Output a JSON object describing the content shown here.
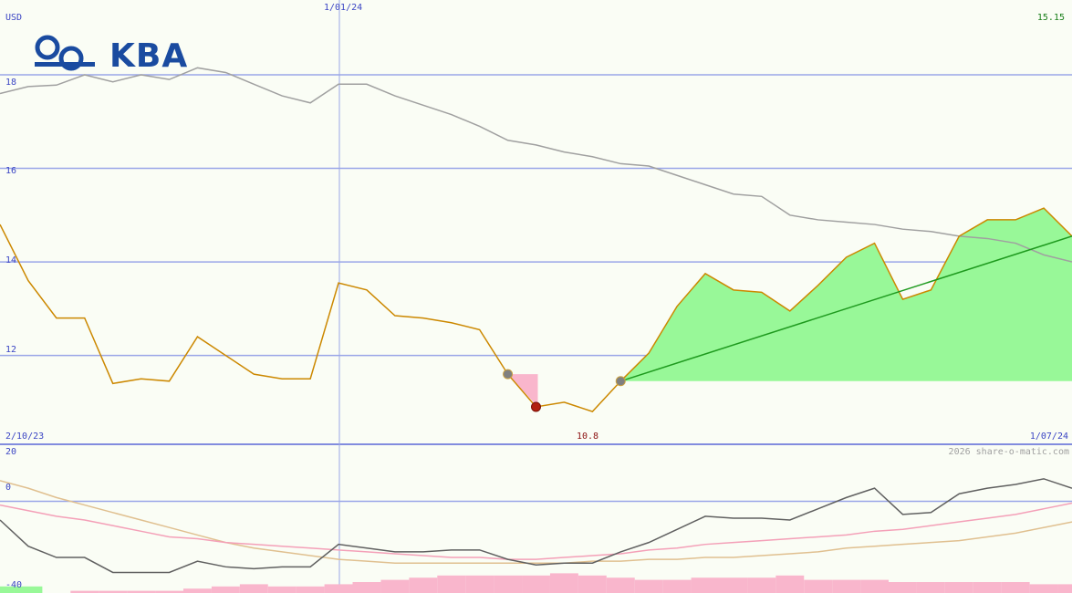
{
  "header": {
    "currency": "USD",
    "date_marker": "1/01/24",
    "last_price": "15.15",
    "start_date": "2/10/23",
    "end_date": "1/07/24",
    "low_label": "10.8",
    "copyright": "2026 share-o-matic.com"
  },
  "logo": {
    "text": "KBA",
    "icon": "kba-rings-logo-icon"
  },
  "colors": {
    "price": "#cc8800",
    "average": "#a0a0a0",
    "trend": "#1e9a1e",
    "gain_fill": "#98f898",
    "loss_fill": "#f9b6cc",
    "grid": "#9aa6e8",
    "axis_text": "#3b45c4"
  },
  "chart_data": [
    {
      "type": "line",
      "title": "",
      "xlabel": "",
      "ylabel": "USD",
      "ylim": [
        10.1,
        19.6
      ],
      "yticks": [
        12,
        14,
        16,
        18
      ],
      "x_range": [
        "2/10/23",
        "1/07/24"
      ],
      "x_marker": "1/01/24",
      "grid": true,
      "series": [
        {
          "role": "price",
          "values": [
            14.8,
            13.6,
            12.8,
            12.8,
            11.4,
            11.5,
            11.45,
            12.4,
            12.0,
            11.6,
            11.5,
            11.5,
            13.55,
            13.4,
            12.85,
            12.8,
            12.7,
            12.55,
            11.6,
            10.9,
            11.0,
            10.8,
            11.45,
            12.05,
            13.05,
            13.75,
            13.4,
            13.35,
            12.95,
            13.5,
            14.1,
            14.4,
            13.2,
            13.4,
            14.55,
            14.9,
            14.9,
            15.15,
            14.55
          ]
        },
        {
          "role": "moving-average",
          "values": [
            17.6,
            17.75,
            17.78,
            18.0,
            17.85,
            18.0,
            17.9,
            18.15,
            18.05,
            17.8,
            17.55,
            17.4,
            17.8,
            17.8,
            17.55,
            17.35,
            17.15,
            16.9,
            16.6,
            16.5,
            16.35,
            16.25,
            16.1,
            16.05,
            15.85,
            15.65,
            15.45,
            15.4,
            15.0,
            14.9,
            14.85,
            14.8,
            14.7,
            14.65,
            14.55,
            14.5,
            14.4,
            14.15,
            14.0
          ]
        }
      ],
      "trend_line": {
        "from": {
          "index": 22,
          "value": 11.45
        },
        "to": {
          "index": 38,
          "value": 14.55
        }
      },
      "annotations": [
        {
          "index": 18,
          "value": 11.6,
          "kind": "marker-grey"
        },
        {
          "index": 19,
          "value": 10.9,
          "kind": "marker-red-low"
        },
        {
          "index": 22,
          "value": 11.45,
          "kind": "marker-grey"
        }
      ]
    },
    {
      "type": "line",
      "title": "",
      "ylim": [
        -40,
        20
      ],
      "yticks": [
        20,
        0,
        -40
      ],
      "grid": true,
      "series": [
        {
          "role": "oscillator",
          "values": [
            -10,
            -24,
            -30,
            -30,
            -38,
            -38,
            -38,
            -32,
            -35,
            -36,
            -35,
            -35,
            -23,
            -25,
            -27,
            -27,
            -26,
            -26,
            -31,
            -34,
            -33,
            -33,
            -27,
            -22,
            -15,
            -8,
            -9,
            -9,
            -10,
            -4,
            2,
            7,
            -7,
            -6,
            4,
            7,
            9,
            12,
            7
          ]
        },
        {
          "role": "signal-pink",
          "values": [
            -2,
            -5,
            -8,
            -10,
            -13,
            -16,
            -19,
            -20,
            -22,
            -23,
            -24,
            -25,
            -26,
            -27,
            -28,
            -29,
            -30,
            -30,
            -31,
            -31,
            -30,
            -29,
            -28,
            -26,
            -25,
            -23,
            -22,
            -21,
            -20,
            -19,
            -18,
            -16,
            -15,
            -13,
            -11,
            -9,
            -7,
            -4,
            -1
          ]
        },
        {
          "role": "signal-tan",
          "values": [
            11,
            7,
            2,
            -2,
            -6,
            -10,
            -14,
            -18,
            -22,
            -25,
            -27,
            -29,
            -31,
            -32,
            -33,
            -33,
            -33,
            -33,
            -33,
            -33,
            -33,
            -32,
            -32,
            -31,
            -31,
            -30,
            -30,
            -29,
            -28,
            -27,
            -25,
            -24,
            -23,
            -22,
            -21,
            -19,
            -17,
            -14,
            -11
          ]
        }
      ],
      "bars": [
        {
          "color": "green",
          "values": [
            3,
            3,
            0,
            0,
            0,
            0,
            0,
            0,
            0,
            0,
            0,
            0,
            0,
            0,
            0,
            0,
            0,
            0,
            0,
            0,
            0,
            0,
            0,
            0,
            0,
            0,
            0,
            0,
            0,
            0,
            0,
            0,
            0,
            0,
            0,
            0,
            0,
            0,
            0
          ]
        },
        {
          "color": "pink",
          "values": [
            0,
            0,
            0,
            1,
            1,
            1,
            1,
            2,
            3,
            4,
            3,
            3,
            4,
            5,
            6,
            7,
            8,
            8,
            8,
            8,
            9,
            8,
            7,
            6,
            6,
            7,
            7,
            7,
            8,
            6,
            6,
            6,
            5,
            5,
            5,
            5,
            5,
            4,
            4
          ]
        }
      ]
    }
  ]
}
